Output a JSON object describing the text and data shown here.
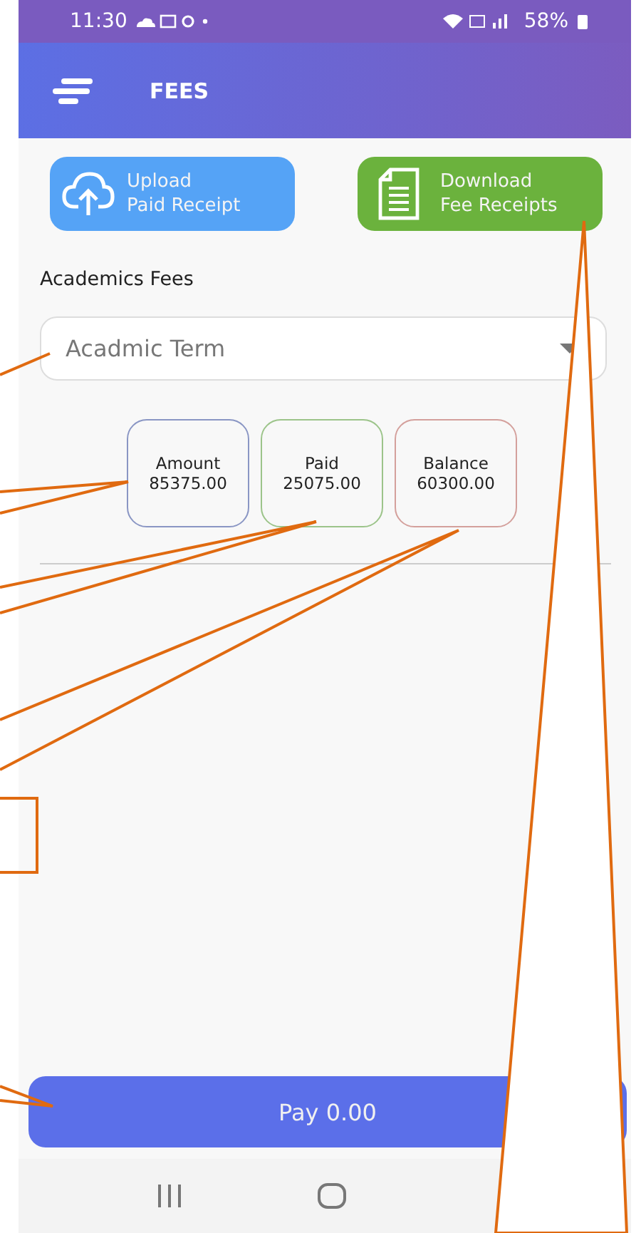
{
  "status_bar": {
    "time": "11:30",
    "battery": "58%"
  },
  "header": {
    "title": "FEES"
  },
  "actions": [
    {
      "kind": "upload",
      "lines": [
        "Upload",
        "Paid Receipt"
      ]
    },
    {
      "kind": "download",
      "lines": [
        "Download",
        "Fee Receipts"
      ]
    }
  ],
  "section_title": "Academics Fees",
  "term_dropdown": {
    "placeholder": "Acadmic Term"
  },
  "summary": [
    {
      "label": "Amount",
      "value": "85375.00",
      "color": "#8a96c4"
    },
    {
      "label": "Paid",
      "value": "25075.00",
      "color": "#9cc48a"
    },
    {
      "label": "Balance",
      "value": "60300.00",
      "color": "#d4a09c"
    }
  ],
  "pay_button": {
    "label": "Pay 0.00"
  }
}
